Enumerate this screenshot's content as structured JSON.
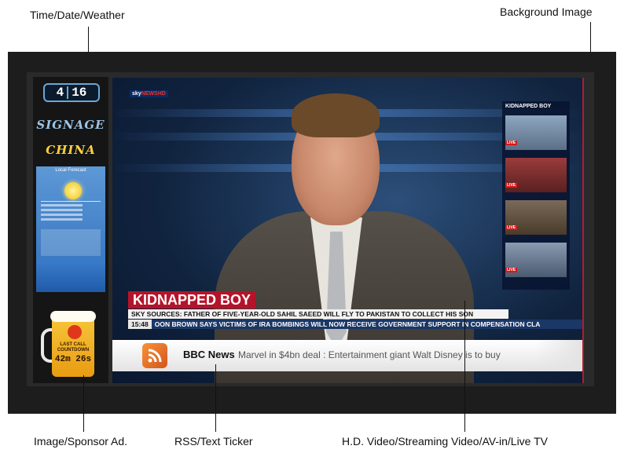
{
  "callouts": {
    "time_date_weather": "Time/Date/Weather",
    "background_image": "Background Image",
    "image_sponsor_ad": "Image/Sponsor Ad.",
    "rss_text_ticker": "RSS/Text Ticker",
    "hd_video": "H.D. Video/Streaming Video/AV-in/Live TV"
  },
  "sidebar": {
    "clock_hours": "4",
    "clock_minutes": "16",
    "logo_line1": "SIGNAGE",
    "logo_line2": "CHINA",
    "weather_title": "Local Forecast"
  },
  "sponsor_ad": {
    "line1": "LAST CALL",
    "line2": "COUNTDOWN",
    "countdown": "42m 26s"
  },
  "video": {
    "channel_logo": "sky",
    "channel_logo_accent": "NEWSHD",
    "headline": "KIDNAPPED BOY",
    "subline": "SKY SOURCES: FATHER OF FIVE-YEAR-OLD SAHIL SAEED WILL FLY TO PAKISTAN TO COLLECT HIS SON",
    "ticker_time": "15:48",
    "ticker_text": "OON BROWN SAYS VICTIMS OF IRA BOMBINGS WILL NOW RECEIVE GOVERNMENT SUPPORT IN COMPENSATION CLA",
    "side_panel_title": "KIDNAPPED BOY",
    "live_label": "LIVE"
  },
  "rss": {
    "source": "BBC News",
    "text": "Marvel in $4bn deal : Entertainment giant Walt Disney is to buy"
  },
  "colors": {
    "headline_red": "#b4142a",
    "ticker_blue": "#1b3766",
    "rss_orange": "#f7923a",
    "monitor_frame": "#1d1d1d"
  }
}
